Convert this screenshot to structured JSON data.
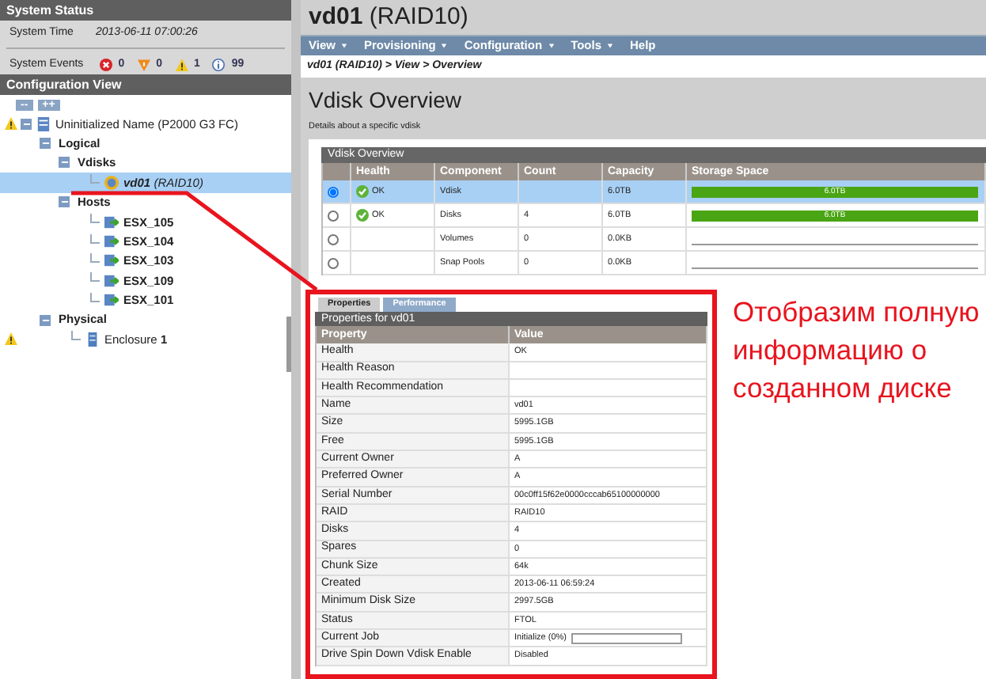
{
  "system_status": {
    "title": "System Status",
    "time_label": "System Time",
    "time": "2013-06-11 07:00:26",
    "events_label": "System Events",
    "events": [
      {
        "kind": "critical",
        "count": "0"
      },
      {
        "kind": "error",
        "count": "0"
      },
      {
        "kind": "warning",
        "count": "1"
      },
      {
        "kind": "info",
        "count": "99"
      }
    ]
  },
  "configuration_view": {
    "title": "Configuration View",
    "buttons": [
      "--",
      "++"
    ],
    "tree": [
      {
        "label": "Uninitialized Name (P2000 G3 FC)",
        "kind": "system",
        "warning": true,
        "selected": false,
        "expanded": true,
        "children": [
          {
            "label": "Logical",
            "kind": "group",
            "warning": false,
            "selected": false,
            "expanded": true,
            "children": [
              {
                "label": "Vdisks",
                "kind": "group",
                "warning": false,
                "selected": false,
                "expanded": true,
                "children": [
                  {
                    "label": "**vd01** (RAID10)",
                    "kind": "vdisk",
                    "warning": false,
                    "selected": true
                  }
                ]
              },
              {
                "label": "Hosts",
                "kind": "group",
                "warning": false,
                "selected": false,
                "expanded": true,
                "children": [
                  {
                    "label": "ESX_105",
                    "kind": "host",
                    "warning": false,
                    "selected": false
                  },
                  {
                    "label": "ESX_104",
                    "kind": "host",
                    "warning": false,
                    "selected": false
                  },
                  {
                    "label": "ESX_103",
                    "kind": "host",
                    "warning": false,
                    "selected": false
                  },
                  {
                    "label": "ESX_109",
                    "kind": "host",
                    "warning": false,
                    "selected": false
                  },
                  {
                    "label": "ESX_101",
                    "kind": "host",
                    "warning": false,
                    "selected": false
                  }
                ]
              }
            ]
          },
          {
            "label": "Physical",
            "kind": "group",
            "warning": false,
            "selected": false,
            "expanded": true,
            "children": [
              {
                "label": "Enclosure **1**",
                "kind": "enclosure",
                "warning": true,
                "selected": false
              }
            ]
          }
        ]
      }
    ]
  },
  "main": {
    "title": "**vd01** (RAID10)",
    "menu": [
      {
        "label": "View",
        "dropdown": true
      },
      {
        "label": "Provisioning",
        "dropdown": true
      },
      {
        "label": "Configuration",
        "dropdown": true
      },
      {
        "label": "Tools",
        "dropdown": true
      },
      {
        "label": "Help",
        "dropdown": false
      }
    ],
    "breadcrumb": "vd01 (RAID10) > View > Overview",
    "heading": "Vdisk Overview",
    "description": "Details about a specific vdisk",
    "overview_table": {
      "title": "Vdisk Overview",
      "columns": [
        "Health",
        "Component",
        "Count",
        "Capacity",
        "Storage Space"
      ],
      "rows": [
        {
          "selected": true,
          "health": "OK",
          "component": "Vdisk",
          "count": "",
          "capacity": "6.0TB",
          "storage": {
            "level": 1,
            "label": "6.0TB"
          }
        },
        {
          "selected": false,
          "health": "OK",
          "component": "Disks",
          "count": "4",
          "capacity": "6.0TB",
          "storage": {
            "level": 1,
            "label": "6.0TB"
          }
        },
        {
          "selected": false,
          "health": "",
          "component": "Volumes",
          "count": "0",
          "capacity": "0.0KB",
          "storage": {
            "level": 0
          }
        },
        {
          "selected": false,
          "health": "",
          "component": "Snap Pools",
          "count": "0",
          "capacity": "0.0KB",
          "storage": {
            "level": 0
          }
        }
      ]
    },
    "properties": {
      "tabs": [
        {
          "label": "Properties",
          "selected": true
        },
        {
          "label": "Performance",
          "selected": false
        }
      ],
      "title": "Properties for vd01",
      "columns": [
        "Property",
        "Value"
      ],
      "rows": [
        {
          "kind": "text",
          "property": "Health",
          "value": "OK"
        },
        {
          "kind": "text",
          "property": "Health Reason",
          "value": ""
        },
        {
          "kind": "text",
          "property": "Health Recommendation",
          "value": ""
        },
        {
          "kind": "text",
          "property": "Name",
          "value": "vd01"
        },
        {
          "kind": "text",
          "property": "Size",
          "value": "5995.1GB"
        },
        {
          "kind": "text",
          "property": "Free",
          "value": "5995.1GB"
        },
        {
          "kind": "text",
          "property": "Current Owner",
          "value": "A"
        },
        {
          "kind": "text",
          "property": "Preferred Owner",
          "value": "A"
        },
        {
          "kind": "text",
          "property": "Serial Number",
          "value": "00c0ff15f62e0000cccab65100000000"
        },
        {
          "kind": "text",
          "property": "RAID",
          "value": "RAID10"
        },
        {
          "kind": "text",
          "property": "Disks",
          "value": "4"
        },
        {
          "kind": "text",
          "property": "Spares",
          "value": "0"
        },
        {
          "kind": "text",
          "property": "Chunk Size",
          "value": "64k"
        },
        {
          "kind": "text",
          "property": "Created",
          "value": "2013-06-11 06:59:24"
        },
        {
          "kind": "text",
          "property": "Minimum Disk Size",
          "value": "2997.5GB"
        },
        {
          "kind": "text",
          "property": "Status",
          "value": "FTOL"
        },
        {
          "kind": "progress",
          "property": "Current Job",
          "value": "Initialize (0%)",
          "level": 0
        },
        {
          "kind": "text",
          "property": "Drive Spin Down Vdisk Enable",
          "value": "Disabled"
        }
      ]
    }
  },
  "annotation": "Отобразим полную информацию о созданном диске"
}
